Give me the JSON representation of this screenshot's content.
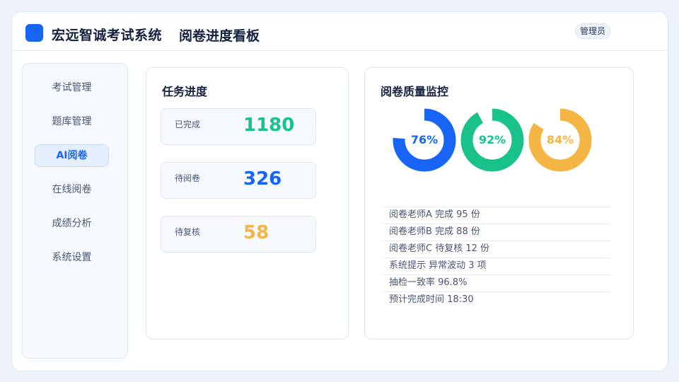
{
  "header": {
    "app_title": "宏远智诚考试系统",
    "page_title": "阅卷进度看板",
    "role_badge": "管理员"
  },
  "sidebar": {
    "items": [
      {
        "label": "考试管理",
        "active": false
      },
      {
        "label": "题库管理",
        "active": false
      },
      {
        "label": "AI阅卷",
        "active": true
      },
      {
        "label": "在线阅卷",
        "active": false
      },
      {
        "label": "成绩分析",
        "active": false
      },
      {
        "label": "系统设置",
        "active": false
      }
    ]
  },
  "progress": {
    "title": "任务进度",
    "stats": [
      {
        "label": "已完成",
        "value": "1180",
        "color": "#19c28a"
      },
      {
        "label": "待阅卷",
        "value": "326",
        "color": "#1764f5"
      },
      {
        "label": "待复核",
        "value": "58",
        "color": "#f5b544"
      }
    ]
  },
  "quality": {
    "title": "阅卷质量监控",
    "donuts": [
      {
        "label": "76%",
        "value": 0.76,
        "color": "#1764f5"
      },
      {
        "label": "92%",
        "value": 0.92,
        "color": "#19c28a"
      },
      {
        "label": "84%",
        "value": 0.84,
        "color": "#f5b544"
      }
    ],
    "logs": [
      "阅卷老师A 完成 95 份",
      "阅卷老师B 完成 88 份",
      "阅卷老师C 待复核 12 份",
      "系统提示 异常波动 3 项",
      "抽检一致率 96.8%",
      "预计完成时间 18:30"
    ]
  }
}
